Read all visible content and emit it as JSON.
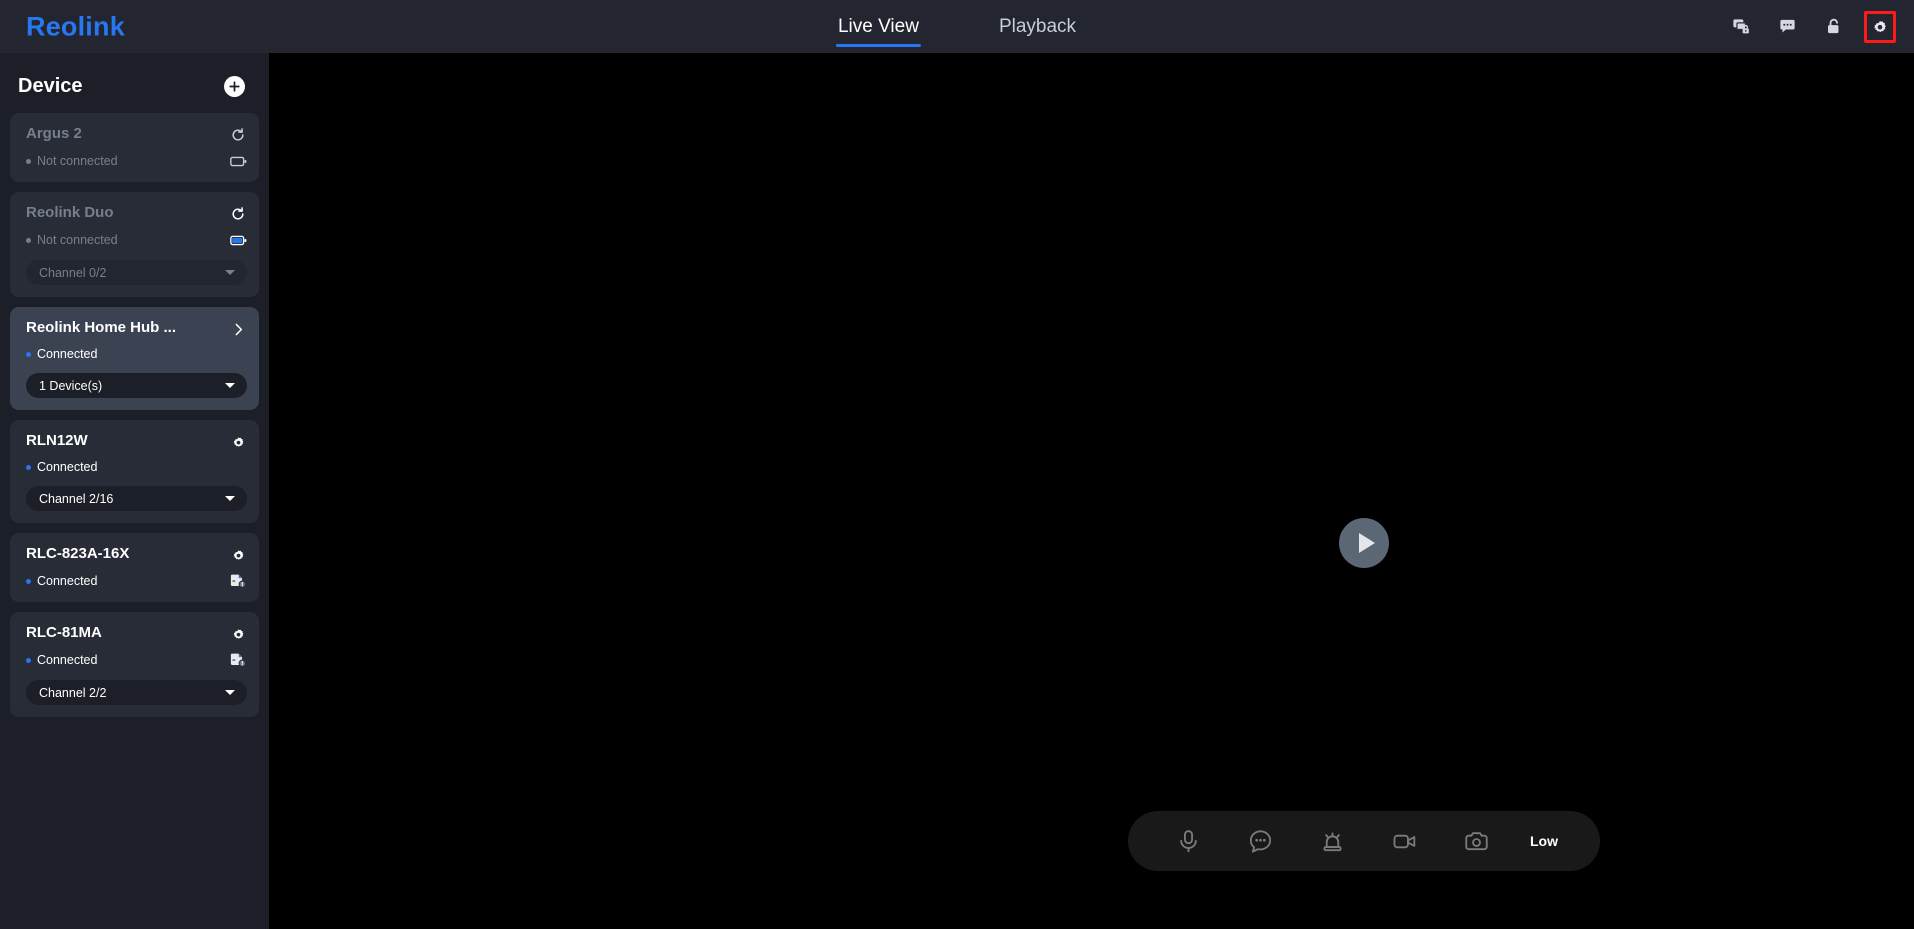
{
  "header": {
    "logo": "Reolink",
    "tabs": [
      {
        "label": "Live View",
        "active": true
      },
      {
        "label": "Playback",
        "active": false
      }
    ],
    "icons": [
      {
        "name": "devices-lock-icon",
        "label": "Device Sharing"
      },
      {
        "name": "chat-bubble-icon",
        "label": "Messages"
      },
      {
        "name": "unlock-padlock-icon",
        "label": "Unlock"
      },
      {
        "name": "gear-icon",
        "label": "Settings",
        "highlighted": true
      }
    ],
    "highlight_color": "#ff1a1a",
    "accent_color": "#2777f0"
  },
  "sidebar": {
    "title": "Device",
    "add_button": "add-device-button",
    "devices": [
      {
        "name": "Argus 2",
        "status": "Not connected",
        "connected": false,
        "action_icon": "refresh-icon",
        "badge_icon": "battery-empty-icon",
        "dropdown": null,
        "selected": false
      },
      {
        "name": "Reolink Duo",
        "status": "Not connected",
        "connected": false,
        "action_icon": "refresh-icon",
        "badge_icon": "battery-full-icon",
        "dropdown": "Channel 0/2",
        "selected": false
      },
      {
        "name": "Reolink Home Hub ...",
        "status": "Connected",
        "connected": true,
        "action_icon": "chevron-right-icon",
        "badge_icon": null,
        "dropdown": "1 Device(s)",
        "selected": true
      },
      {
        "name": "RLN12W",
        "status": "Connected",
        "connected": true,
        "action_icon": "gear-icon",
        "badge_icon": null,
        "dropdown": "Channel 2/16",
        "selected": false
      },
      {
        "name": "RLC-823A-16X",
        "status": "Connected",
        "connected": true,
        "action_icon": "gear-icon",
        "badge_icon": "sd-card-warning-icon",
        "dropdown": null,
        "selected": false
      },
      {
        "name": "RLC-81MA",
        "status": "Connected",
        "connected": true,
        "action_icon": "gear-icon",
        "badge_icon": "sd-card-warning-icon",
        "dropdown": "Channel 2/2",
        "selected": false
      }
    ]
  },
  "stage": {
    "play_button": "play-button",
    "background": "#000000"
  },
  "toolbar": {
    "items": [
      {
        "name": "microphone-icon",
        "label": "Microphone"
      },
      {
        "name": "two-way-talk-icon",
        "label": "Two-Way Talk"
      },
      {
        "name": "siren-icon",
        "label": "Siren"
      },
      {
        "name": "record-video-icon",
        "label": "Record"
      },
      {
        "name": "snapshot-camera-icon",
        "label": "Snapshot"
      }
    ],
    "quality": "Low"
  }
}
